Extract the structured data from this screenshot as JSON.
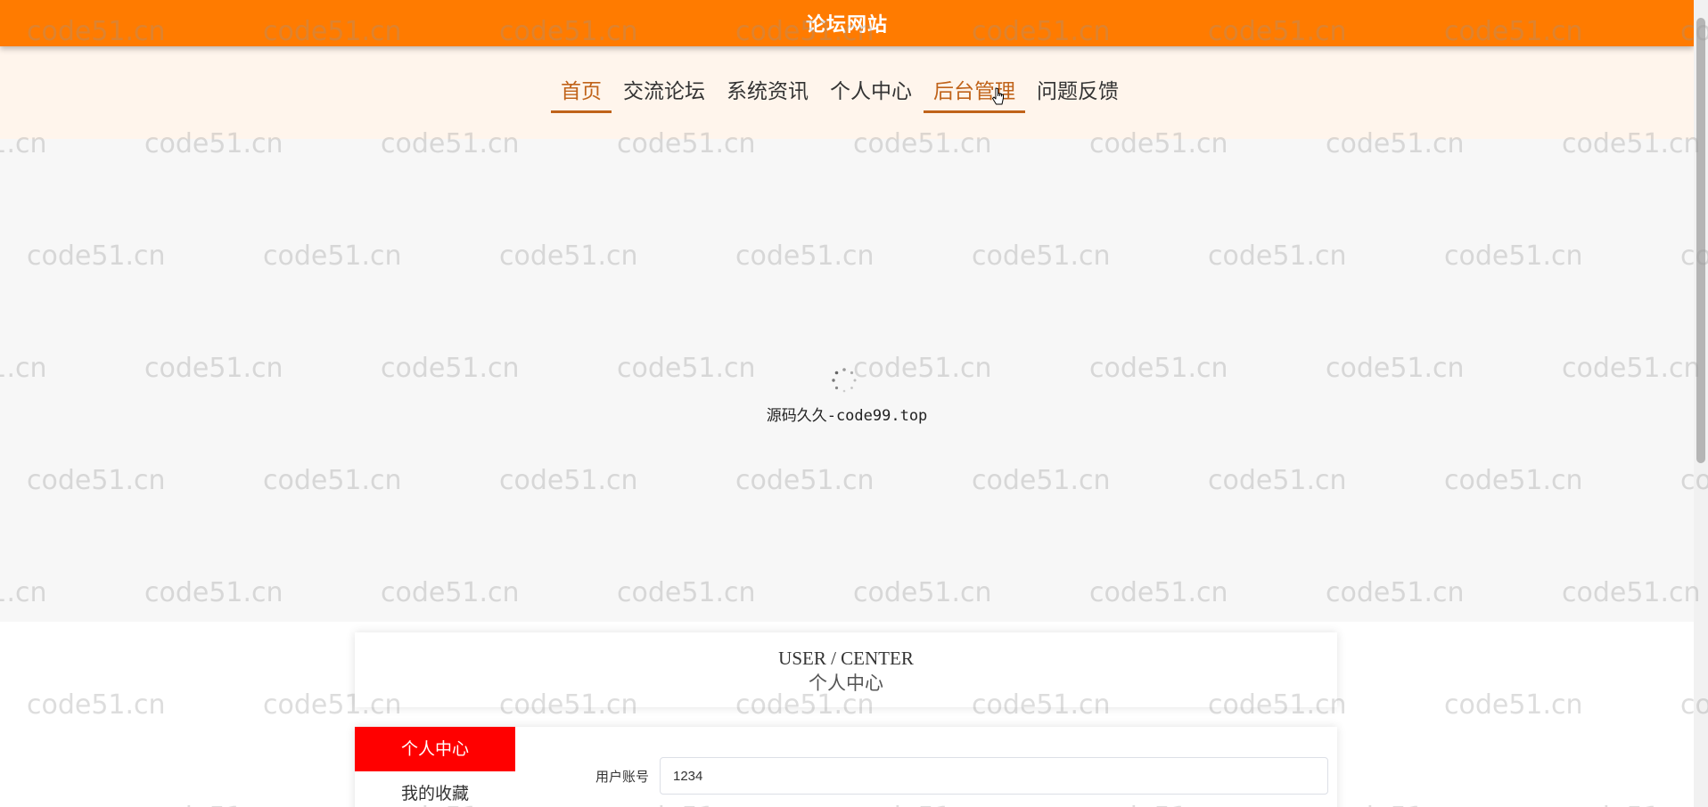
{
  "header": {
    "site_title": "论坛网站"
  },
  "nav": {
    "items": [
      {
        "label": "首页",
        "active": true
      },
      {
        "label": "交流论坛",
        "active": false
      },
      {
        "label": "系统资讯",
        "active": false
      },
      {
        "label": "个人中心",
        "active": false
      },
      {
        "label": "后台管理",
        "active": true
      },
      {
        "label": "问题反馈",
        "active": false
      }
    ]
  },
  "loading": {
    "text": "源码久久-code99.top"
  },
  "user_center": {
    "title_en": "USER / CENTER",
    "title_zh": "个人中心"
  },
  "side_menu": {
    "items": [
      {
        "label": "个人中心",
        "active": true
      },
      {
        "label": "我的收藏",
        "active": false
      }
    ]
  },
  "form": {
    "account_label": "用户账号",
    "account_value": "1234"
  },
  "watermark": {
    "text": "code51.cn"
  },
  "colors": {
    "brand": "#ff7b00",
    "nav_active": "#c0631a",
    "side_active": "#ff0000"
  }
}
